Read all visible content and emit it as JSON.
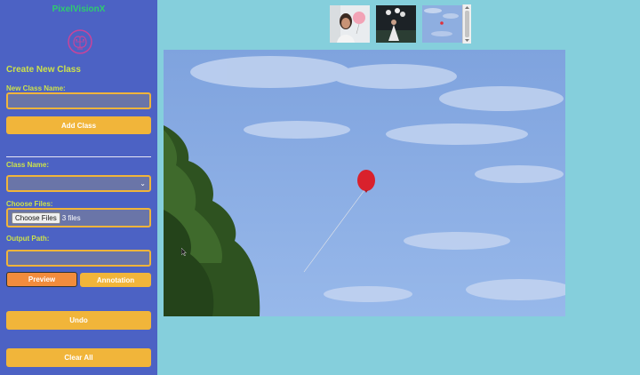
{
  "app": {
    "title": "PixelVisionX",
    "logo_icon": "brain-circuit-logo-icon"
  },
  "sidebar": {
    "create_heading": "Create New Class",
    "new_class_label": "New Class Name:",
    "new_class_value": "",
    "add_class_button": "Add Class",
    "class_name_label": "Class Name:",
    "class_name_selected": "",
    "choose_files_label": "Choose Files:",
    "choose_files_button": "Choose Files",
    "files_selected": "3 files",
    "output_path_label": "Output Path:",
    "output_path_value": "",
    "preview_button": "Preview",
    "annotation_button": "Annotation",
    "undo_button": "Undo",
    "clear_all_button": "Clear All"
  },
  "colors": {
    "sidebar_bg": "#4c62c4",
    "page_bg": "#85cfdc",
    "accent_button": "#f1b53a",
    "active_button": "#f28c3c",
    "label_color": "#cde24a",
    "title_color": "#2ecc6e"
  },
  "thumbnails": [
    {
      "name": "girl-with-pink-balloon",
      "selected": false
    },
    {
      "name": "person-with-balloons-dark",
      "selected": false
    },
    {
      "name": "red-balloon-sky",
      "selected": true
    }
  ],
  "main_image": {
    "name": "red-balloon-sky"
  }
}
